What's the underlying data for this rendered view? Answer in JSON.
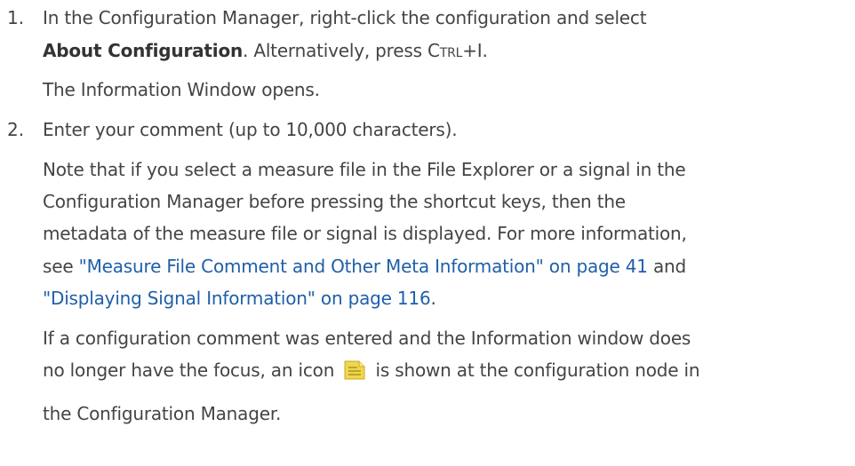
{
  "steps": [
    {
      "number": "1.",
      "line1": "In the Configuration Manager, right-click the configuration and select",
      "line2_bold": "About Configuration",
      "line2_rest": ". Alternatively, press ",
      "shortcut": "Ctrl+I",
      "line2_end": ".",
      "result": "The Information Window opens."
    },
    {
      "number": "2.",
      "instruction": "Enter your comment (up to 10,000 characters).",
      "note_lines": [
        "Note that if you select a measure file in the File Explorer or a signal in the",
        "Configuration Manager before pressing the shortcut keys, then the",
        "metadata of the measure file or signal is displayed. For more information,"
      ],
      "see_prefix": "see ",
      "link1": "\"Measure File Comment and Other Meta Information\" on page 41",
      "and_text": " and",
      "link2": "\"Displaying Signal Information\" on page 116",
      "link2_end": ".",
      "comment_line1": "If a configuration comment was entered and the Information window does",
      "comment_line2_pre": "no longer have the focus, an icon",
      "comment_line2_post": "is shown at the configuration node in",
      "comment_line3": "the Configuration Manager."
    }
  ],
  "icon_name": "note-icon",
  "colors": {
    "text": "#444444",
    "link": "#1f5fa8",
    "icon": "#f2d64b"
  }
}
